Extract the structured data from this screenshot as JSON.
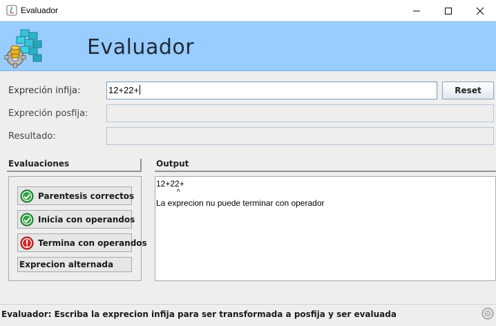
{
  "window": {
    "title": "Evaluador",
    "controls": {
      "minimize": "minimize",
      "maximize": "maximize",
      "close": "close"
    }
  },
  "banner": {
    "heading": "Evaluador",
    "logo_icon": "database-gear-icon"
  },
  "form": {
    "infija_label": "Expreción infija:",
    "infija_value": "12+22+",
    "posfija_label": "Expreción posfija:",
    "posfija_value": "",
    "resultado_label": "Resultado:",
    "resultado_value": "",
    "reset_label": "Reset"
  },
  "evaluaciones": {
    "header": "Evaluaciones",
    "items": [
      {
        "label": "Parentesis correctos",
        "status": "ok",
        "icon": "check-circle-icon"
      },
      {
        "label": "Inicia con operandos",
        "status": "ok",
        "icon": "check-circle-icon"
      },
      {
        "label": "Termina con operandos",
        "status": "error",
        "icon": "error-circle-icon"
      },
      {
        "label": "Exprecion alternada",
        "status": "none",
        "icon": ""
      }
    ]
  },
  "output": {
    "header": "Output",
    "expression": "12+22+",
    "pointer": "^",
    "message": "La exprecion nu puede terminar con operador"
  },
  "status": {
    "message": "Evaluador: Escriba la exprecion infija para ser transformada a posfija y ser evaluada",
    "grip_icon": "disc-icon"
  },
  "colors": {
    "banner": "#99ccff",
    "ok": "#2ea043",
    "error": "#d62828"
  }
}
